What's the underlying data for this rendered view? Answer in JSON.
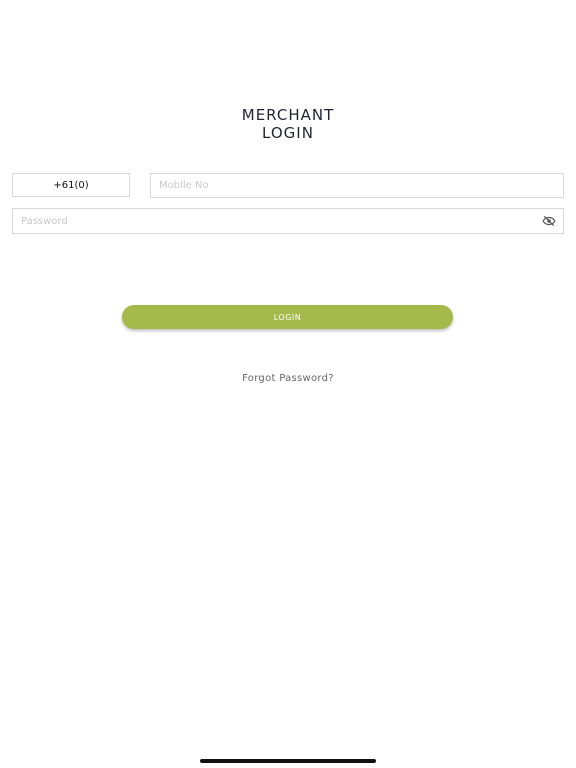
{
  "header": {
    "title_line1": "MERCHANT",
    "title_line2": "LOGIN"
  },
  "form": {
    "country_code": "+61(0)",
    "mobile_placeholder": "Mobile No",
    "password_placeholder": "Password",
    "password_toggle_icon": "eye-off-icon",
    "login_label": "LOGIN",
    "forgot_label": "Forgot Password?"
  },
  "colors": {
    "accent": "#a6ba4b",
    "title": "#1f2433",
    "border": "#d8d8d8"
  }
}
